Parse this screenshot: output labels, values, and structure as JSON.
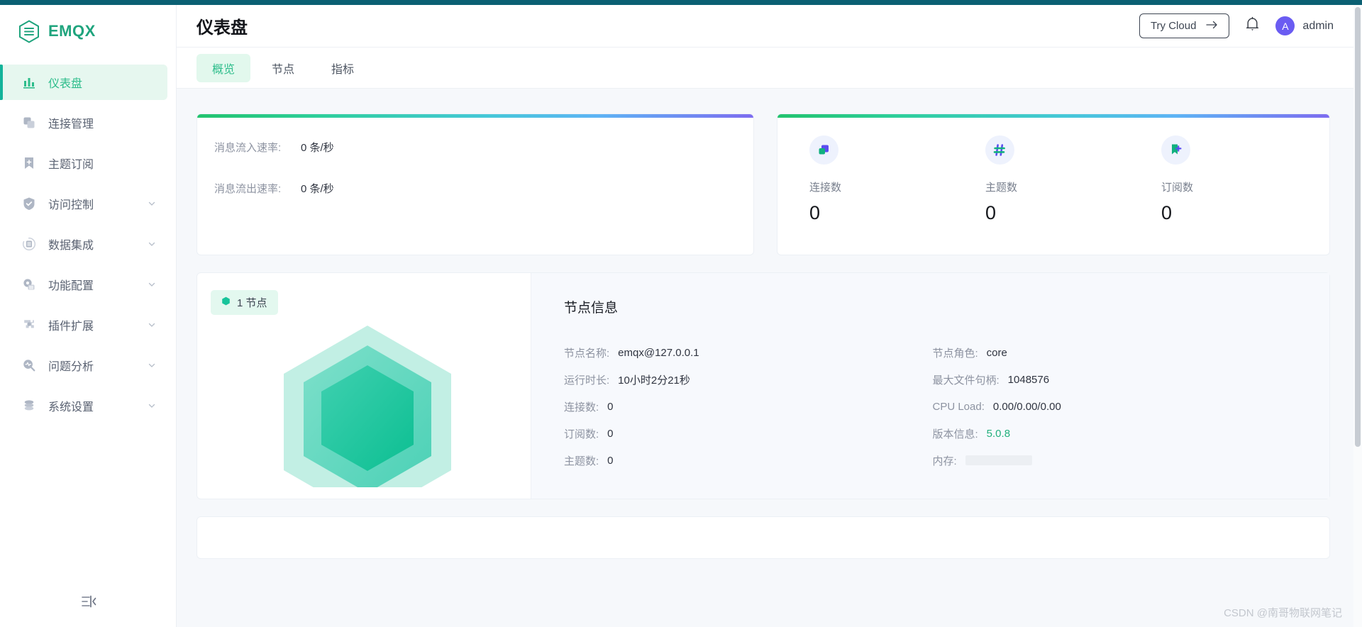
{
  "theme": {
    "accent_green": "#2dbd8b",
    "brand_green": "#1fa47d",
    "topbar_teal": "#0b6073",
    "avatar_purple": "#6a5cf2",
    "gradient": [
      "#22c36e",
      "#2ecf9b",
      "#45c8d8",
      "#5db4f5",
      "#7d6cf0"
    ]
  },
  "sidebar": {
    "brand": "EMQX",
    "brand_icon": "emqx-hexagon-logo-icon",
    "collapse_icon": "sidebar-collapse-icon",
    "items": [
      {
        "label": "仪表盘",
        "icon": "dashboard-bars-icon",
        "active": true,
        "expandable": false
      },
      {
        "label": "连接管理",
        "icon": "connections-icon",
        "active": false,
        "expandable": false
      },
      {
        "label": "主题订阅",
        "icon": "topic-bookmark-icon",
        "active": false,
        "expandable": false
      },
      {
        "label": "访问控制",
        "icon": "shield-check-icon",
        "active": false,
        "expandable": true
      },
      {
        "label": "数据集成",
        "icon": "database-circle-icon",
        "active": false,
        "expandable": true
      },
      {
        "label": "功能配置",
        "icon": "gear-list-icon",
        "active": false,
        "expandable": true
      },
      {
        "label": "插件扩展",
        "icon": "puzzle-piece-icon",
        "active": false,
        "expandable": true
      },
      {
        "label": "问题分析",
        "icon": "pulse-search-icon",
        "active": false,
        "expandable": true
      },
      {
        "label": "系统设置",
        "icon": "layers-stack-icon",
        "active": false,
        "expandable": true
      }
    ]
  },
  "header": {
    "title": "仪表盘",
    "try_cloud_label": "Try Cloud",
    "try_cloud_arrow_icon": "arrow-right-icon",
    "bell_icon": "notification-bell-icon",
    "avatar_initial": "A",
    "user_name": "admin"
  },
  "tabs": [
    {
      "label": "概览",
      "active": true
    },
    {
      "label": "节点",
      "active": false
    },
    {
      "label": "指标",
      "active": false
    }
  ],
  "rate_card": {
    "rows": [
      {
        "label": "消息流入速率:",
        "value": "0 条/秒"
      },
      {
        "label": "消息流出速率:",
        "value": "0 条/秒"
      }
    ]
  },
  "stats_card": {
    "stats": [
      {
        "icon": "connections-square-icon",
        "label": "连接数",
        "value": "0"
      },
      {
        "icon": "hash-topic-icon",
        "label": "主题数",
        "value": "0"
      },
      {
        "icon": "subscription-flag-icon",
        "label": "订阅数",
        "value": "0"
      }
    ]
  },
  "node_panel": {
    "badge_label": "1 节点",
    "badge_icon": "hexagon-dot-icon",
    "graphic_icon": "node-hexagon-graphic-icon",
    "title": "节点信息",
    "left_info": [
      {
        "key": "节点名称:",
        "value": "emqx@127.0.0.1"
      },
      {
        "key": "运行时长:",
        "value": "10小时2分21秒"
      },
      {
        "key": "连接数:",
        "value": "0"
      },
      {
        "key": "订阅数:",
        "value": "0"
      },
      {
        "key": "主题数:",
        "value": "0"
      }
    ],
    "right_info": [
      {
        "key": "节点角色:",
        "value": "core"
      },
      {
        "key": "最大文件句柄:",
        "value": "1048576"
      },
      {
        "key": "CPU Load:",
        "value": "0.00/0.00/0.00"
      },
      {
        "key": "版本信息:",
        "value": "5.0.8",
        "green": true
      },
      {
        "key": "内存:",
        "value": "",
        "memory_bar": true,
        "memory_percent": 20
      }
    ]
  },
  "watermark": "CSDN @南哥物联网笔记"
}
